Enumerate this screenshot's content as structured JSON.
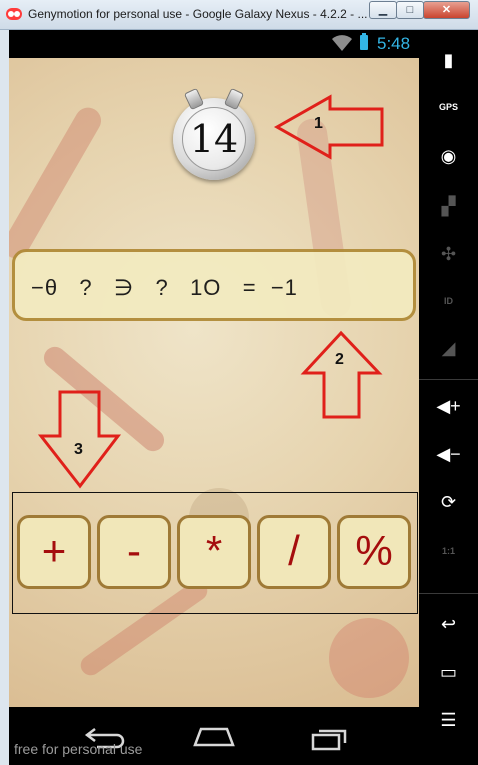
{
  "window": {
    "title": "Genymotion for personal use - Google Galaxy Nexus - 4.2.2 - ...",
    "min_label": "▁",
    "max_label": "□",
    "close_label": "✕"
  },
  "status": {
    "time": "5:48"
  },
  "game": {
    "timer": "14",
    "equation": "−θ   ?   ∋   ?   1O   =  −1",
    "operators": [
      "+",
      "-",
      "*",
      "/",
      "%"
    ]
  },
  "annotations": {
    "a1": "1",
    "a2": "2",
    "a3": "3"
  },
  "watermark": "free for personal use",
  "sidebar": {
    "gps": "GPS",
    "id": "ID",
    "ratio": "1:1"
  },
  "colors": {
    "accent": "#33b5e5",
    "operator": "#a50d0d",
    "annotation": "#e0201a"
  }
}
